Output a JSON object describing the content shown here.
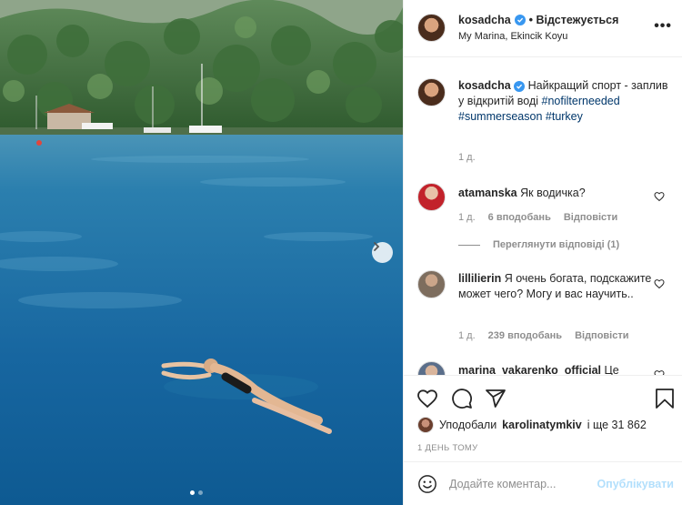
{
  "post": {
    "author": "kosadcha",
    "follow_status": "• Відстежується",
    "location": "My Marina, Ekincik Koyu",
    "more_icon": "more-horizontal-icon"
  },
  "caption": {
    "username": "kosadcha",
    "text": "Найкращий спорт - заплив у відкритій воді",
    "hashtags": [
      "#nofilterneeded",
      "#summerseason",
      "#turkey"
    ],
    "age": "1 д."
  },
  "comments": [
    {
      "username": "atamanska",
      "text": "Як водичка?",
      "age": "1 д.",
      "likes": "6 вподобань",
      "reply": "Відповісти",
      "view_replies": "Переглянути відповіді (1)"
    },
    {
      "username": "lillilierin",
      "text": "Я очень богата, подскажите может чего? Могу и вас научить..",
      "age": "1 д.",
      "likes": "239 вподобань",
      "reply": "Відповісти"
    },
    {
      "username": "marina_vakarenko_official",
      "text": "Це"
    }
  ],
  "actions": {
    "liked_by_prefix": "Уподобали",
    "liked_by_user": "karolinatymkiv",
    "liked_by_suffix": "і ще 31 862",
    "timestamp": "1 ДЕНЬ ТОМУ"
  },
  "comment_box": {
    "placeholder": "Додайте коментар...",
    "publish_label": "Опублікувати"
  },
  "carousel": {
    "current": 1,
    "total": 2
  },
  "colors": {
    "link": "#00376b",
    "verified": "#3897f0",
    "publish_disabled": "#b2dffc",
    "muted": "#8e8e8e"
  }
}
